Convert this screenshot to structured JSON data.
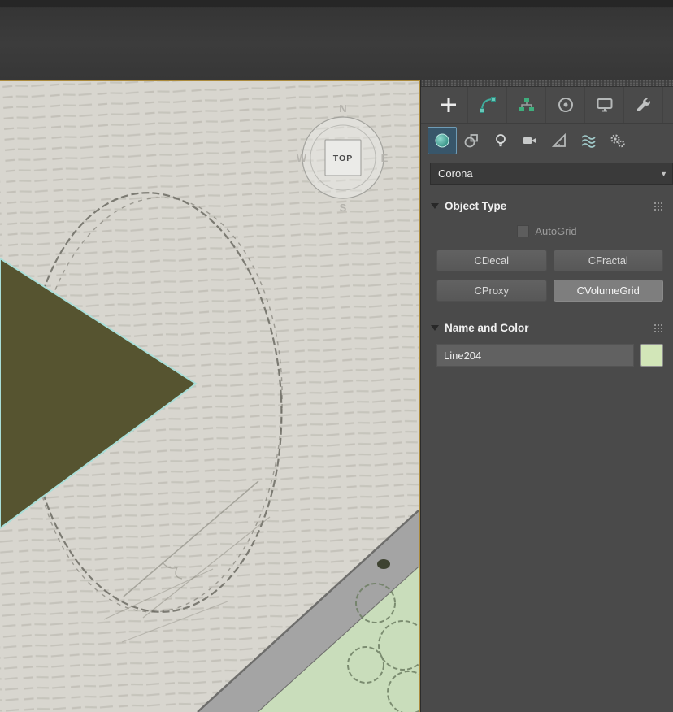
{
  "colors": {
    "viewport_active_border": "#ab8a3c",
    "selection_cyan": "#a9ded8",
    "object_olive": "#565430",
    "swatch_green": "#d2e6b8",
    "subtab_active_bg": "#38566a"
  },
  "viewport": {
    "viewcube": {
      "face_label": "TOP",
      "north": "N",
      "south": "S",
      "east": "E",
      "west": "W"
    }
  },
  "command_panel": {
    "tabs": [
      {
        "icon": "create-plus-icon"
      },
      {
        "icon": "modify-icon"
      },
      {
        "icon": "hierarchy-icon"
      },
      {
        "icon": "motion-icon"
      },
      {
        "icon": "display-icon"
      },
      {
        "icon": "utilities-wrench-icon"
      }
    ],
    "subtabs": [
      {
        "icon": "geometry-sphere-icon",
        "active": true
      },
      {
        "icon": "shapes-icon"
      },
      {
        "icon": "lights-icon"
      },
      {
        "icon": "cameras-icon"
      },
      {
        "icon": "helpers-icon"
      },
      {
        "icon": "spacewarps-icon"
      },
      {
        "icon": "systems-icon"
      }
    ],
    "category_dropdown": {
      "value": "Corona",
      "arrow": "▼"
    },
    "object_type": {
      "title": "Object Type",
      "autogrid_label": "AutoGrid",
      "autogrid_checked": false,
      "buttons": [
        "CDecal",
        "CFractal",
        "CProxy",
        "CVolumeGrid"
      ],
      "active_button": "CVolumeGrid"
    },
    "name_and_color": {
      "title": "Name and Color",
      "name_value": "Line204"
    }
  }
}
